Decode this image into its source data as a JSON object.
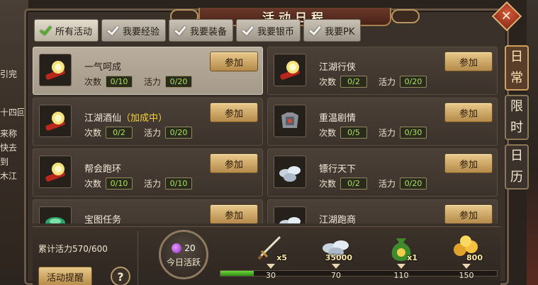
{
  "window": {
    "title": "活动日程",
    "close_label": "✕"
  },
  "world_background": {
    "lines": [
      "引完",
      "十四回",
      "来称",
      "快去",
      "到",
      "木江"
    ]
  },
  "filter_tabs": [
    {
      "label": "所有活动",
      "active": true
    },
    {
      "label": "我要经验",
      "active": false
    },
    {
      "label": "我要装备",
      "active": false
    },
    {
      "label": "我要银币",
      "active": false
    },
    {
      "label": "我要PK",
      "active": false
    }
  ],
  "side_tabs": [
    {
      "chars": [
        "日",
        "常"
      ],
      "active": true
    },
    {
      "chars": [
        "限",
        "时"
      ],
      "active": false
    },
    {
      "chars": [
        "日",
        "历"
      ],
      "active": false
    }
  ],
  "activities": [
    {
      "name": "一气呵成",
      "name_suffix": "",
      "count_label": "次数",
      "count": "0/10",
      "vitality_label": "活力",
      "vitality": "0/20",
      "join_label": "参加",
      "icon": "scroll-treasure-icon",
      "selected": true
    },
    {
      "name": "江湖行侠",
      "name_suffix": "",
      "count_label": "次数",
      "count": "0/2",
      "vitality_label": "活力",
      "vitality": "0/20",
      "join_label": "参加",
      "icon": "scroll-treasure-icon",
      "selected": false
    },
    {
      "name": "江湖酒仙",
      "name_suffix": "（加成中）",
      "count_label": "次数",
      "count": "0/2",
      "vitality_label": "活力",
      "vitality": "0/20",
      "join_label": "参加",
      "icon": "scroll-treasure-icon",
      "selected": false
    },
    {
      "name": "重温剧情",
      "name_suffix": "",
      "count_label": "次数",
      "count": "0/5",
      "vitality_label": "活力",
      "vitality": "0/30",
      "join_label": "参加",
      "icon": "armor-icon",
      "selected": false
    },
    {
      "name": "帮会跑环",
      "name_suffix": "",
      "count_label": "次数",
      "count": "0/10",
      "vitality_label": "活力",
      "vitality": "0/10",
      "join_label": "参加",
      "icon": "scroll-treasure-icon",
      "selected": false
    },
    {
      "name": "镖行天下",
      "name_suffix": "",
      "count_label": "次数",
      "count": "0/2",
      "vitality_label": "活力",
      "vitality": "0/20",
      "join_label": "参加",
      "icon": "silver-coins-icon",
      "selected": false
    },
    {
      "name": "宝图任务",
      "name_suffix": "",
      "count_label": "",
      "count": "",
      "vitality_label": "",
      "vitality": "",
      "join_label": "参加",
      "icon": "jade-icon",
      "selected": false
    },
    {
      "name": "江湖跑商",
      "name_suffix": "",
      "count_label": "",
      "count": "",
      "vitality_label": "",
      "vitality": "",
      "join_label": "参加",
      "icon": "silver-coins-icon",
      "selected": false
    }
  ],
  "bottom": {
    "total_vitality": "累计活力570/600",
    "remind_label": "活动提醒",
    "help_label": "?",
    "today_value": "20",
    "today_label": "今日活跃",
    "progress_fraction": 0.12,
    "rewards": [
      {
        "icon": "flying-sword-icon",
        "qty": "x5",
        "threshold": "30"
      },
      {
        "icon": "silver-coins-icon",
        "qty": "35000",
        "threshold": "70"
      },
      {
        "icon": "money-bag-icon",
        "qty": "x1",
        "threshold": "110"
      },
      {
        "icon": "gold-coins-icon",
        "qty": "800",
        "threshold": "150"
      }
    ]
  },
  "colors": {
    "stat_text": "#a6e35a",
    "highlight": "#f5d23a",
    "button": "#d3b272",
    "progress": "#4fbf25"
  }
}
